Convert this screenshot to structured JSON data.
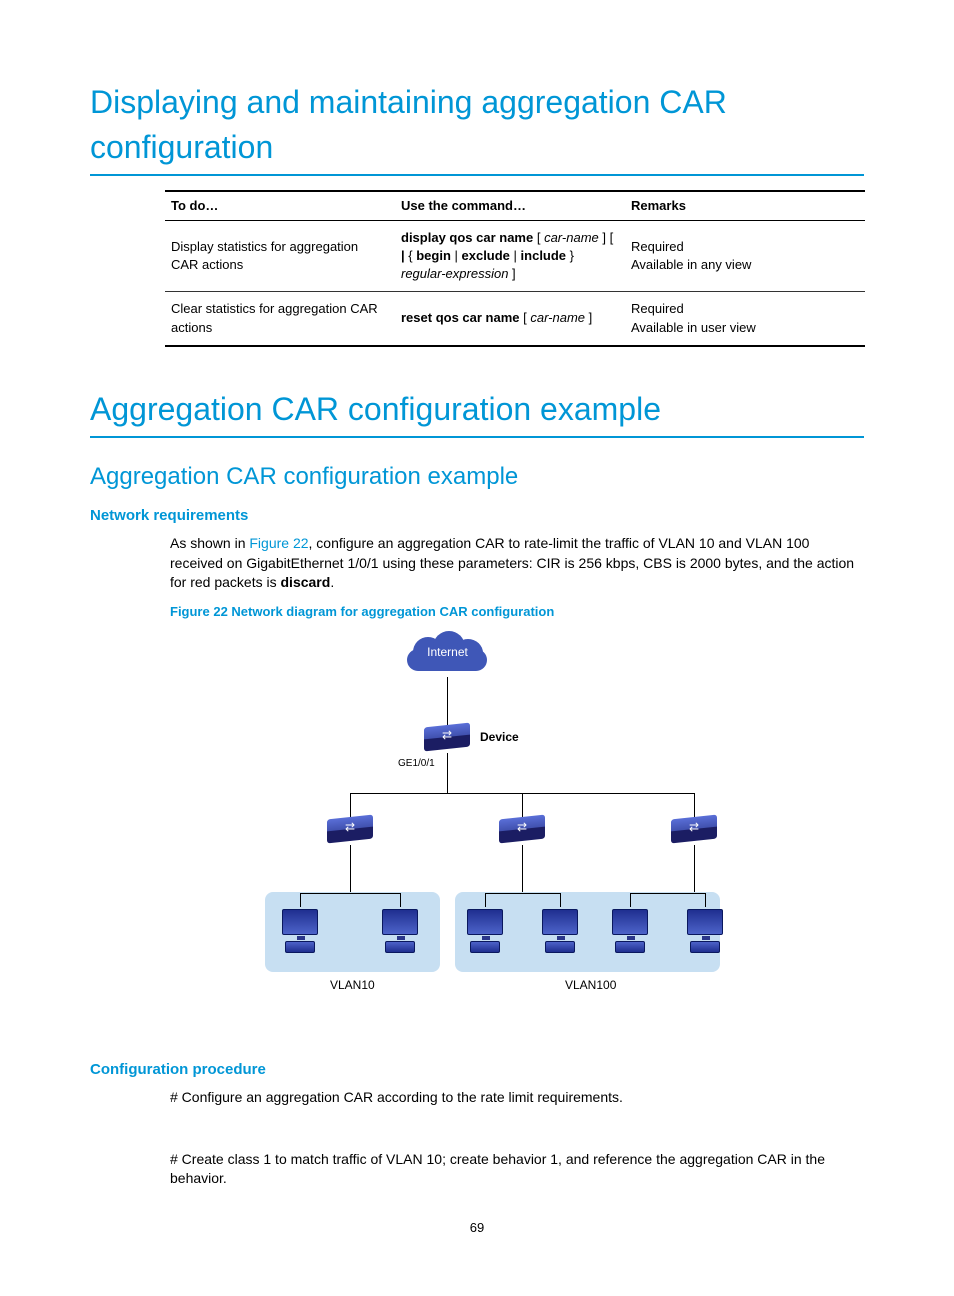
{
  "h1a": "Displaying and maintaining aggregation CAR configuration",
  "table": {
    "head": {
      "a": "To do…",
      "b": "Use the command…",
      "c": "Remarks"
    },
    "rows": [
      {
        "a": "Display statistics for aggregation CAR actions",
        "b_html": "<span class='bold'>display qos car name</span> [ <span class='ital'>car-name</span> ] [ <span class='bold'>|</span> { <span class='bold'>begin</span> | <span class='bold'>exclude</span> | <span class='bold'>include</span> } <span class='ital'>regular-expression</span> ]",
        "c": "Required\nAvailable in any view"
      },
      {
        "a": "Clear statistics for aggregation CAR actions",
        "b_html": "<span class='bold'>reset qos car name</span> [ <span class='ital'>car-name</span> ]",
        "c": "Required\nAvailable in user view"
      }
    ]
  },
  "h1b": "Aggregation CAR configuration example",
  "h2a": "Aggregation CAR configuration example",
  "h3a": "Network requirements",
  "para1_pre": "As shown in ",
  "figlink": "Figure 22",
  "para1_post": ", configure an aggregation CAR to rate-limit the traffic of VLAN 10 and VLAN 100 received on GigabitEthernet 1/0/1 using these parameters: CIR is 256 kbps, CBS is 2000 bytes, and the action for red packets is ",
  "discard": "discard",
  "period": ".",
  "figcap": "Figure 22 Network diagram for aggregation CAR configuration",
  "diagram": {
    "internet": "Internet",
    "device": "Device",
    "port": "GE1/0/1",
    "vlan10": "VLAN10",
    "vlan100": "VLAN100"
  },
  "h3b": "Configuration procedure",
  "para2": "# Configure an aggregation CAR according to the rate limit requirements.",
  "para3": "# Create class 1 to match traffic of VLAN 10; create behavior 1, and reference the aggregation CAR in the behavior.",
  "pagenum": "69"
}
